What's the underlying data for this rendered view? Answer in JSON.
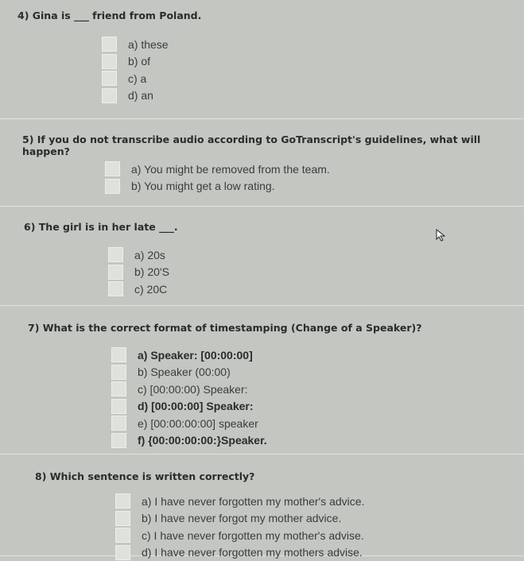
{
  "questions": [
    {
      "title": "4) Gina is ___ friend from Poland.",
      "options": [
        {
          "label": "a) these"
        },
        {
          "label": "b) of"
        },
        {
          "label": "c) a"
        },
        {
          "label": "d) an"
        }
      ]
    },
    {
      "title": "5) If you do not transcribe audio according to GoTranscript's guidelines, what will happen?",
      "options": [
        {
          "label": "a) You might be removed from the team."
        },
        {
          "label": "b) You might get a low rating."
        }
      ]
    },
    {
      "title": "6) The girl is in her late ___.",
      "options": [
        {
          "label": "a) 20s"
        },
        {
          "label": "b) 20'S"
        },
        {
          "label": "c) 20C"
        }
      ]
    },
    {
      "title": "7) What is the correct format of timestamping (Change of a Speaker)?",
      "options": [
        {
          "label": "a) Speaker: [00:00:00]",
          "bold": true
        },
        {
          "label": "b) Speaker (00:00)"
        },
        {
          "label": "c) [00:00:00) Speaker:"
        },
        {
          "label": "d) [00:00:00] Speaker:",
          "bold": true
        },
        {
          "label": "e) [00:00:00:00] speaker"
        },
        {
          "label": "f) {00:00:00:00:}Speaker.",
          "bold": true
        }
      ]
    },
    {
      "title": "8) Which sentence is written correctly?",
      "options": [
        {
          "label": "a) I have never forgotten my mother's advice."
        },
        {
          "label": "b) I have never forgot my mother advice."
        },
        {
          "label": "c) I have never forgotten my mother's advise."
        },
        {
          "label": "d) I have never forgotten my mothers advise."
        }
      ]
    }
  ],
  "cursor_icon": "mouse-pointer-icon"
}
